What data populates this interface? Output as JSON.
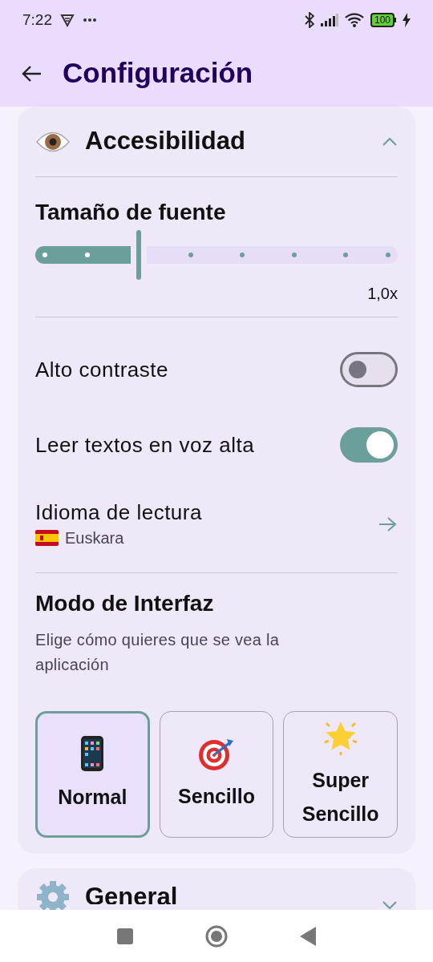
{
  "status_bar": {
    "time": "7:22",
    "battery": "100"
  },
  "app_bar": {
    "title": "Configuración"
  },
  "sections": [
    {
      "kind": "eye",
      "title": "Accesibilidad",
      "expanded": true,
      "font_size": {
        "label": "Tamaño de fuente",
        "level": 0.2857,
        "reading": "1,0x"
      },
      "toggles": [
        {
          "label": "Alto contraste",
          "on": false
        },
        {
          "label": "Leer textos en voz alta",
          "on": true
        }
      ],
      "reading_language": {
        "label": "Idioma de lectura",
        "value": "Euskara"
      },
      "interface_mode": {
        "title": "Modo de Interfaz",
        "description": "Elige cómo quieres que se vea la aplicación",
        "options": [
          {
            "kind": "phone",
            "label": "Normal",
            "selected": true
          },
          {
            "kind": "target",
            "label": "Sencillo",
            "selected": false
          },
          {
            "kind": "star",
            "label": "Super Sencillo",
            "selected": false
          }
        ]
      }
    },
    {
      "kind": "gear",
      "title": "General",
      "expanded": false
    }
  ]
}
